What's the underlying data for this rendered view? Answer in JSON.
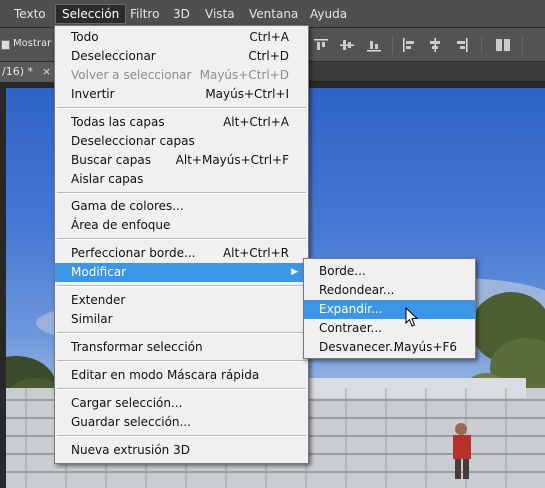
{
  "menubar": {
    "items": [
      {
        "label": "Texto"
      },
      {
        "label": "Selección"
      },
      {
        "label": "Filtro"
      },
      {
        "label": "3D"
      },
      {
        "label": "Vista"
      },
      {
        "label": "Ventana"
      },
      {
        "label": "Ayuda"
      }
    ]
  },
  "options": {
    "show_transform_label": "Mostrar c"
  },
  "document": {
    "tab_label": "/16) *",
    "close_glyph": "×"
  },
  "selection_menu": {
    "items": [
      {
        "label": "Todo",
        "shortcut": "Ctrl+A"
      },
      {
        "label": "Deseleccionar",
        "shortcut": "Ctrl+D"
      },
      {
        "label": "Volver a seleccionar",
        "shortcut": "Mayús+Ctrl+D"
      },
      {
        "label": "Invertir",
        "shortcut": "Mayús+Ctrl+I"
      },
      {
        "label": "Todas las capas",
        "shortcut": "Alt+Ctrl+A"
      },
      {
        "label": "Deseleccionar capas",
        "shortcut": ""
      },
      {
        "label": "Buscar capas",
        "shortcut": "Alt+Mayús+Ctrl+F"
      },
      {
        "label": "Aislar capas",
        "shortcut": ""
      },
      {
        "label": "Gama de colores...",
        "shortcut": ""
      },
      {
        "label": "Área de enfoque",
        "shortcut": ""
      },
      {
        "label": "Perfeccionar borde...",
        "shortcut": "Alt+Ctrl+R"
      },
      {
        "label": "Modificar",
        "shortcut": ""
      },
      {
        "label": "Extender",
        "shortcut": ""
      },
      {
        "label": "Similar",
        "shortcut": ""
      },
      {
        "label": "Transformar selección",
        "shortcut": ""
      },
      {
        "label": "Editar en modo Máscara rápida",
        "shortcut": ""
      },
      {
        "label": "Cargar selección...",
        "shortcut": ""
      },
      {
        "label": "Guardar selección...",
        "shortcut": ""
      },
      {
        "label": "Nueva extrusión 3D",
        "shortcut": ""
      }
    ],
    "submenu_arrow": "▶"
  },
  "modify_submenu": {
    "items": [
      {
        "label": "Borde...",
        "shortcut": ""
      },
      {
        "label": "Redondear...",
        "shortcut": ""
      },
      {
        "label": "Expandir...",
        "shortcut": ""
      },
      {
        "label": "Contraer...",
        "shortcut": ""
      },
      {
        "label": "Desvanecer...",
        "shortcut": "Mayús+F6"
      }
    ]
  },
  "colors": {
    "highlight": "#3c96e6",
    "menubar_bg": "#4f4f4f",
    "menu_bg": "#f0f0f0"
  },
  "icons": [
    "align-top-icon",
    "align-vcenter-icon",
    "align-bottom-icon",
    "align-left-icon",
    "align-hcenter-icon",
    "align-right-icon",
    "distribute-icon",
    "mouse-pointer-icon"
  ]
}
